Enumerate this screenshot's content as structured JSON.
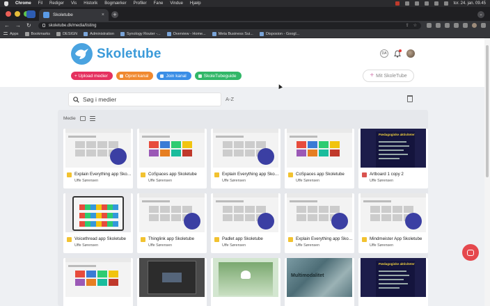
{
  "menubar": {
    "app": "Chrome",
    "items": [
      "Fil",
      "Rediger",
      "Vis",
      "Historik",
      "Bogmærker",
      "Profiler",
      "Fane",
      "Vindue",
      "Hjælp"
    ],
    "datetime": "tor. 24. jan.  09.45"
  },
  "tab": {
    "title": "Skoletube",
    "close": "×"
  },
  "newtab": "+",
  "address": {
    "url": "skoletube.dk/media/listing"
  },
  "bookmarks": [
    "Apps",
    "Bookmarks",
    "DESIGN",
    "Administration",
    "Synology Router -...",
    "Overview - Home...",
    "Meta Business Sui...",
    "Disposion - Googl..."
  ],
  "site": {
    "name": "Skoletube",
    "lang": "DA",
    "actions": [
      "+ Upload medier",
      "Opret kanal",
      "Join kanal",
      "SkoleTubeguide"
    ],
    "mit": "Mit SkoleTube",
    "search_placeholder": "Søg i medier",
    "sort_label": "A-Z",
    "media_label": "Medie"
  },
  "media": [
    {
      "title": "Explain Everything app Skoletube",
      "author": "Uffe Sørensen",
      "kind": "app"
    },
    {
      "title": "CoSpaces app Skoletube",
      "author": "Uffe Sørensen",
      "kind": "color"
    },
    {
      "title": "Explain Everything app Skoletube",
      "author": "Uffe Sørensen",
      "kind": "app"
    },
    {
      "title": "CoSpaces app Skoletube",
      "author": "Uffe Sørensen",
      "kind": "color"
    },
    {
      "title": "Artboard 1 copy 2",
      "author": "Uffe Sørensen",
      "kind": "dark",
      "overlay": "Pædagogiske aktiviteter"
    },
    {
      "title": "Voicethread app Skoletube",
      "author": "Uffe Sørensen",
      "kind": "ipad"
    },
    {
      "title": "Thinglink app Skoletube",
      "author": "Uffe Sørensen",
      "kind": "app"
    },
    {
      "title": "Padlet app Skoletube",
      "author": "Uffe Sørensen",
      "kind": "app"
    },
    {
      "title": "Explain Everything app Skoletube",
      "author": "Uffe Sørensen",
      "kind": "app"
    },
    {
      "title": "Mindmeister App Skoletube",
      "author": "Uffe Sørensen",
      "kind": "app"
    },
    {
      "title": "",
      "author": "",
      "kind": "color"
    },
    {
      "title": "",
      "author": "",
      "kind": "dim"
    },
    {
      "title": "",
      "author": "",
      "kind": "green"
    },
    {
      "title": "",
      "author": "",
      "kind": "texture",
      "overlay": "Multimodalitet"
    },
    {
      "title": "",
      "author": "",
      "kind": "dark",
      "overlay": "Pædagogiske aktiviteter"
    }
  ]
}
